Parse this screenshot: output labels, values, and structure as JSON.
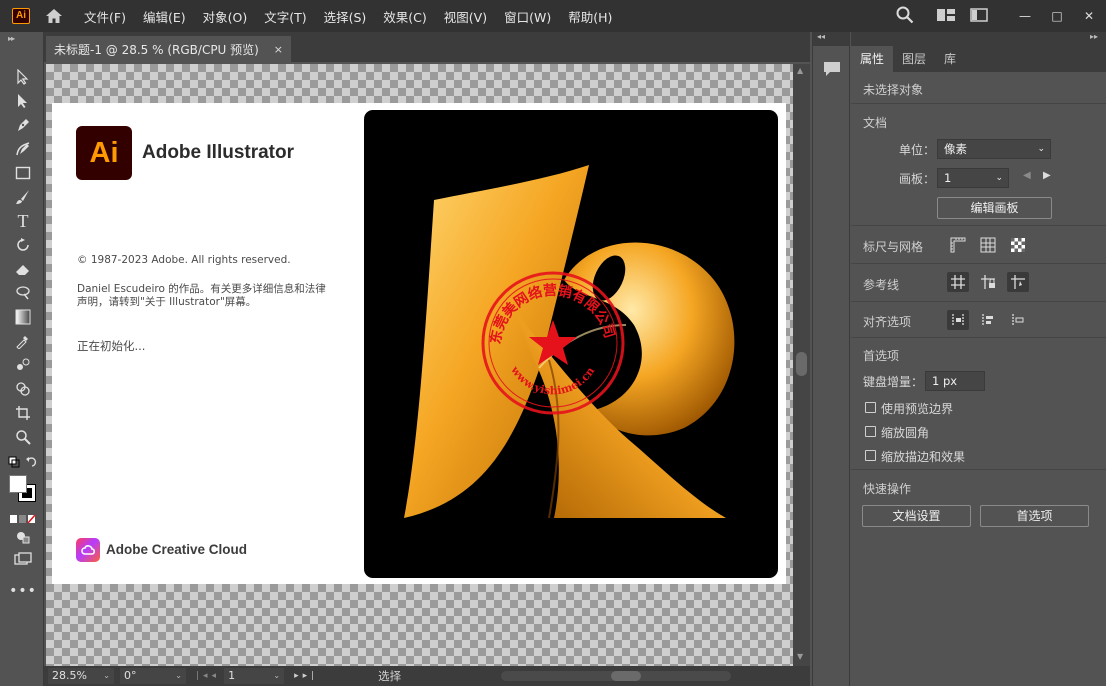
{
  "app": {
    "logo_text": "Ai"
  },
  "menu": [
    "文件(F)",
    "编辑(E)",
    "对象(O)",
    "文字(T)",
    "选择(S)",
    "效果(C)",
    "视图(V)",
    "窗口(W)",
    "帮助(H)"
  ],
  "document_tab": {
    "title": "未标题-1 @ 28.5 % (RGB/CPU 预览)",
    "close": "×"
  },
  "splash": {
    "logo_text": "Ai",
    "product_name": "Adobe Illustrator",
    "copyright": "© 1987-2023 Adobe. All rights reserved.",
    "credits": "Daniel Escudeiro 的作品。有关更多详细信息和法律声明，请转到\"关于 Illustrator\"屏幕。",
    "status": "正在初始化...",
    "brand": "Adobe Creative Cloud",
    "artwork_colors": {
      "primary": "#f5a623",
      "shadow": "#b86a00",
      "highlight": "#ffd873"
    }
  },
  "watermark": {
    "arc_text": "东莞美网络营销有限公司",
    "bottom_text": "www.yishimei.cn",
    "color": "#e5121c"
  },
  "right_panel": {
    "tabs": [
      "属性",
      "图层",
      "库"
    ],
    "active_tab": "属性",
    "no_selection": "未选择对象",
    "document": {
      "title": "文档",
      "unit_label": "单位：",
      "unit_value": "像素",
      "artboard_label": "画板：",
      "artboard_value": "1",
      "edit_artboards": "编辑画板"
    },
    "rulers_grids_label": "标尺与网格",
    "guides_label": "参考线",
    "align_options_label": "对齐选项",
    "preferences": {
      "title": "首选项",
      "keyboard_increment_label": "键盘增量：",
      "keyboard_increment_value": "1 px",
      "use_preview_bounds": "使用预览边界",
      "scale_corners": "缩放圆角",
      "scale_strokes_effects": "缩放描边和效果"
    },
    "quick_actions": {
      "title": "快速操作",
      "document_setup": "文档设置",
      "preferences": "首选项"
    }
  },
  "statusbar": {
    "zoom": "28.5%",
    "rotation": "0°",
    "artboard": "1",
    "tool": "选择"
  }
}
